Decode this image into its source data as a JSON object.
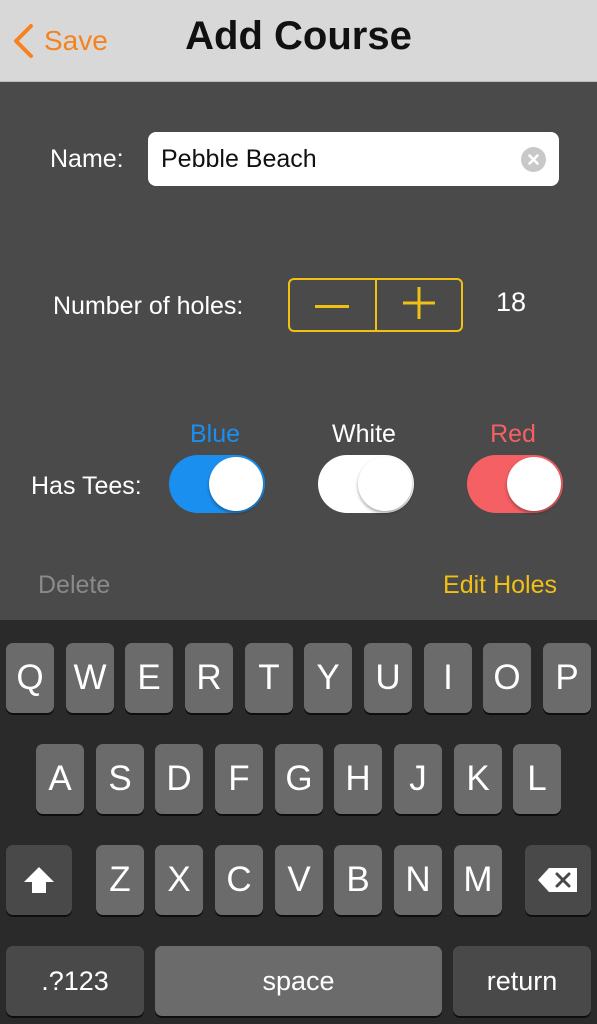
{
  "nav": {
    "back_label": "Save",
    "title": "Add Course",
    "accent": "#f5821f"
  },
  "form": {
    "name_label": "Name:",
    "name_value": "Pebble Beach",
    "holes_label": "Number of holes:",
    "holes_value": "18",
    "stepper_minus": "minus-icon",
    "stepper_plus": "plus-icon",
    "tees_label": "Has Tees:",
    "tees": [
      {
        "label": "Blue",
        "on": true,
        "color": "#1a8ff0"
      },
      {
        "label": "White",
        "on": true,
        "color": "#ffffff"
      },
      {
        "label": "Red",
        "on": true,
        "color": "#f46064"
      }
    ],
    "delete_label": "Delete",
    "edit_label": "Edit Holes",
    "stepper_color": "#f0c014"
  },
  "keyboard": {
    "row1": [
      "Q",
      "W",
      "E",
      "R",
      "T",
      "Y",
      "U",
      "I",
      "O",
      "P"
    ],
    "row2": [
      "A",
      "S",
      "D",
      "F",
      "G",
      "H",
      "J",
      "K",
      "L"
    ],
    "row3": [
      "Z",
      "X",
      "C",
      "V",
      "B",
      "N",
      "M"
    ],
    "shift_icon": "shift-arrow-icon",
    "backspace_icon": "backspace-icon",
    "numbers_label": ".?123",
    "space_label": "space",
    "return_label": "return"
  }
}
